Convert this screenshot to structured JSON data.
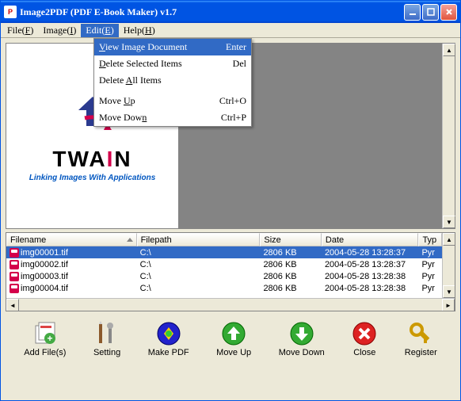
{
  "window": {
    "title": "Image2PDF (PDF E-Book Maker) v1.7"
  },
  "menubar": {
    "file": "File(F)",
    "image": "Image(I)",
    "edit": "Edit(E)",
    "help": "Help(H)"
  },
  "dropdown": {
    "view": {
      "label": "View Image Document",
      "shortcut": "Enter"
    },
    "delsel": {
      "label": "Delete Selected Items",
      "shortcut": "Del"
    },
    "delall": {
      "label": "Delete All Items",
      "shortcut": ""
    },
    "moveup": {
      "label": "Move Up",
      "shortcut": "Ctrl+O"
    },
    "movedown": {
      "label": "Move Down",
      "shortcut": "Ctrl+P"
    }
  },
  "logo": {
    "brand": "TWAIN",
    "tagline": "Linking Images With Applications"
  },
  "table": {
    "headers": {
      "filename": "Filename",
      "filepath": "Filepath",
      "size": "Size",
      "date": "Date",
      "type": "Typ"
    },
    "rows": [
      {
        "filename": "img00001.tif",
        "filepath": "C:\\",
        "size": "2806 KB",
        "date": "2004-05-28 13:28:37",
        "type": "Pyr"
      },
      {
        "filename": "img00002.tif",
        "filepath": "C:\\",
        "size": "2806 KB",
        "date": "2004-05-28 13:28:37",
        "type": "Pyr"
      },
      {
        "filename": "img00003.tif",
        "filepath": "C:\\",
        "size": "2806 KB",
        "date": "2004-05-28 13:28:38",
        "type": "Pyr"
      },
      {
        "filename": "img00004.tif",
        "filepath": "C:\\",
        "size": "2806 KB",
        "date": "2004-05-28 13:28:38",
        "type": "Pyr"
      }
    ]
  },
  "toolbar": {
    "add": "Add File(s)",
    "setting": "Setting",
    "makepdf": "Make PDF",
    "moveup": "Move Up",
    "movedown": "Move Down",
    "close": "Close",
    "register": "Register"
  }
}
